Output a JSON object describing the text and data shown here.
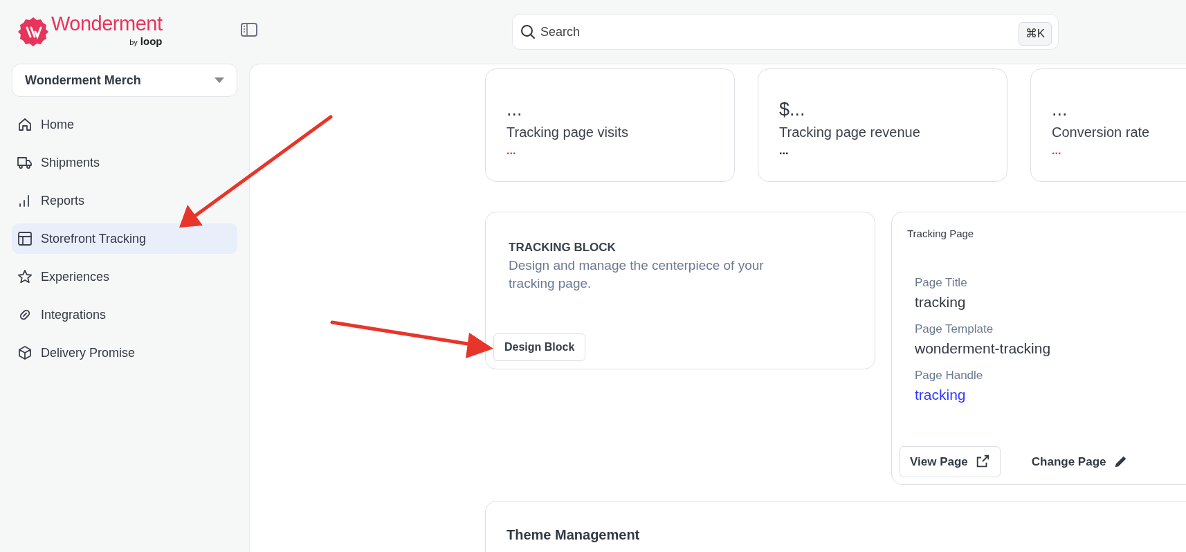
{
  "brand": {
    "name": "Wonderment",
    "byline_prefix": "by",
    "byline_name": "loop"
  },
  "store_selector": {
    "value": "Wonderment Merch"
  },
  "nav": [
    {
      "label": "Home",
      "selected": false
    },
    {
      "label": "Shipments",
      "selected": false
    },
    {
      "label": "Reports",
      "selected": false
    },
    {
      "label": "Storefront Tracking",
      "selected": true
    },
    {
      "label": "Experiences",
      "selected": false
    },
    {
      "label": "Integrations",
      "selected": false
    },
    {
      "label": "Delivery Promise",
      "selected": false
    }
  ],
  "search": {
    "placeholder": "Search",
    "shortcut": "⌘K"
  },
  "stats": [
    {
      "value": "...",
      "label": "Tracking page visits",
      "change": "...",
      "color": "#e53935"
    },
    {
      "value": "$...",
      "label": "Tracking page revenue",
      "change": "...",
      "color": "#111111"
    },
    {
      "value": "...",
      "label": "Conversion rate",
      "change": "...",
      "color": "#e53935"
    }
  ],
  "tracking_block": {
    "title": "TRACKING BLOCK",
    "description": "Design and manage the centerpiece of your tracking page.",
    "button": "Design Block"
  },
  "tracking_page": {
    "title": "Tracking Page",
    "fields": [
      {
        "label": "Page Title",
        "value": "tracking",
        "kind": "text"
      },
      {
        "label": "Page Template",
        "value": "wonderment-tracking",
        "kind": "text"
      },
      {
        "label": "Page Handle",
        "value": "tracking",
        "kind": "link"
      }
    ],
    "actions": [
      {
        "label": "View Page",
        "kind": "outline"
      },
      {
        "label": "Change Page",
        "kind": "plain"
      }
    ]
  },
  "theme_management": {
    "title": "Theme Management"
  }
}
